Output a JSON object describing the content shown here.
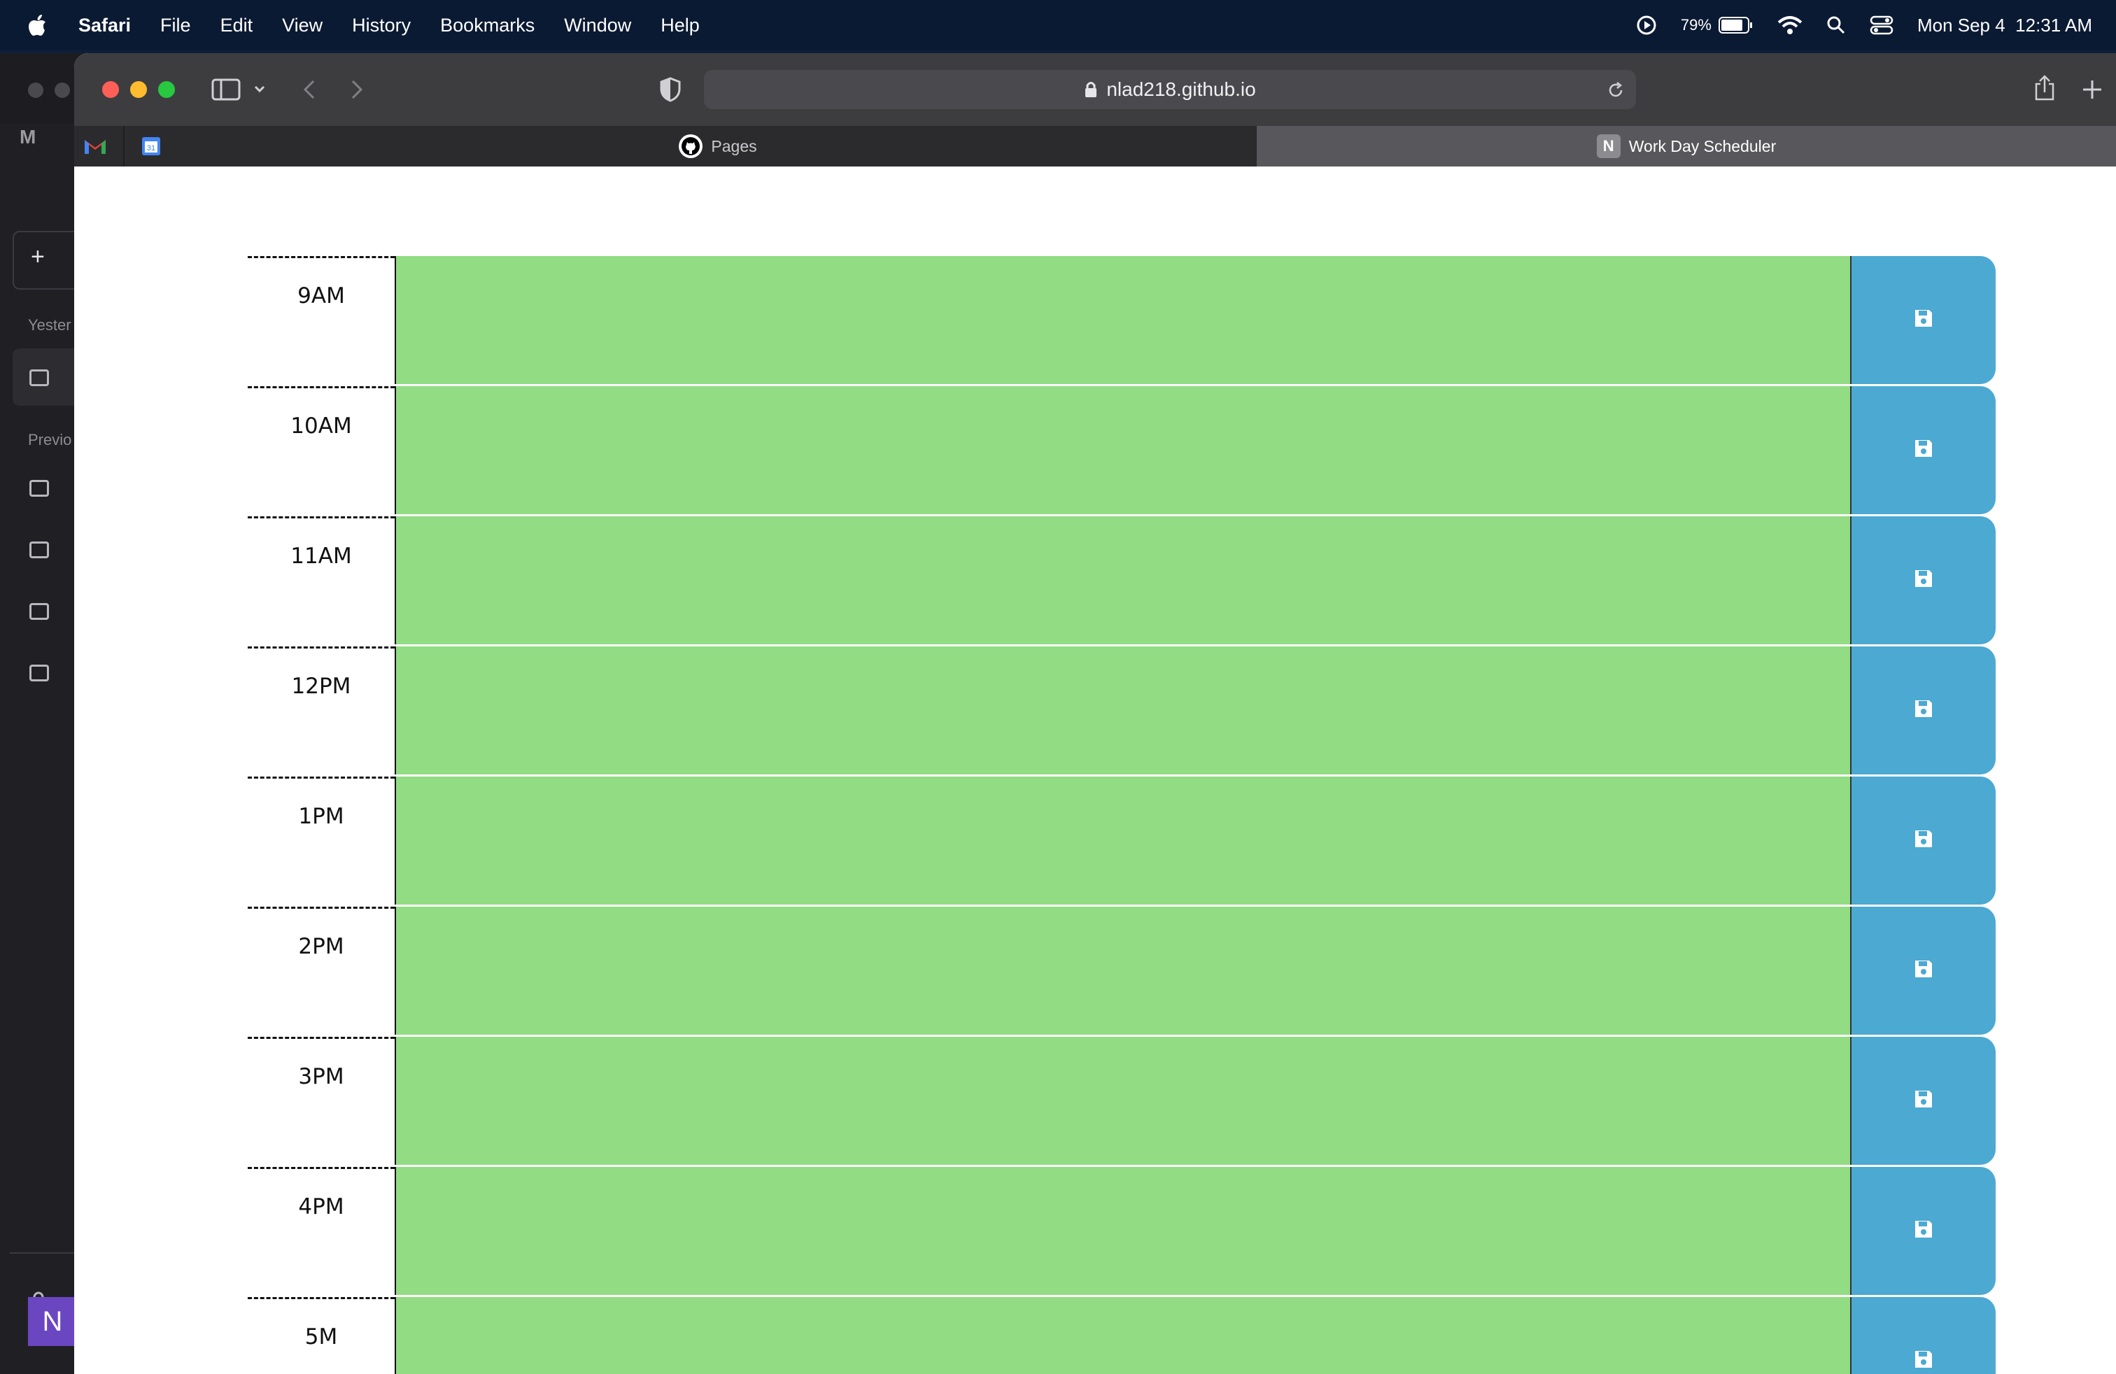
{
  "menubar": {
    "app_name": "Safari",
    "menus": [
      "File",
      "Edit",
      "View",
      "History",
      "Bookmarks",
      "Window",
      "Help"
    ],
    "battery": "79%",
    "datetime": "Mon Sep 4  12:31 AM"
  },
  "background_window": {
    "sidebar_labels": [
      "Yester",
      "Previo"
    ],
    "new_chat_glyph": "+",
    "avatar_letter": "N"
  },
  "safari": {
    "url": "nlad218.github.io",
    "tabs": [
      {
        "label": "Pages",
        "icon": "github-icon"
      },
      {
        "label": "Work Day Scheduler",
        "icon": "notion-icon",
        "active": true
      }
    ]
  },
  "scheduler": {
    "hours": [
      "9AM",
      "10AM",
      "11AM",
      "12PM",
      "1PM",
      "2PM",
      "3PM",
      "4PM",
      "5M"
    ],
    "colors": {
      "present": "#92dc83",
      "save_button": "#4ba9d2"
    }
  }
}
